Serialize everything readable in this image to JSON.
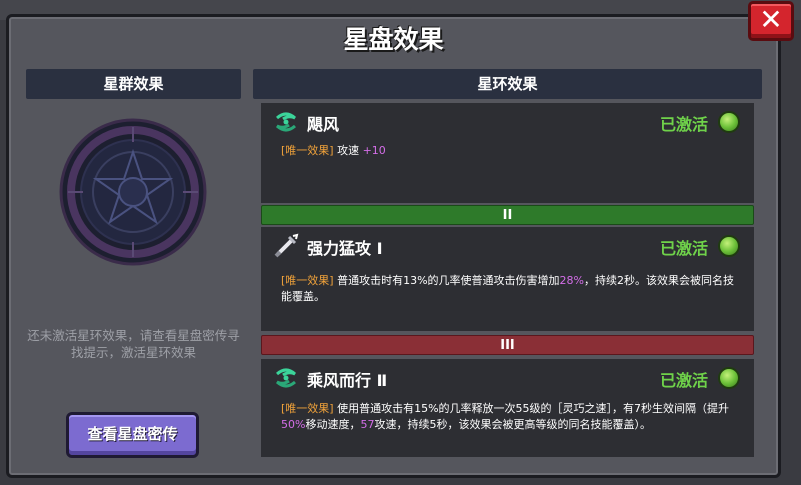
{
  "dialog": {
    "title": "星盘效果",
    "close_label": "✕"
  },
  "constellation": {
    "header": "星群效果",
    "hint": "还未激活星环效果，请查看星盘密传寻找提示，激活星环效果",
    "button_label": "查看星盘密传"
  },
  "ring": {
    "header": "星环效果",
    "dividers": [
      "II",
      "III"
    ],
    "effects": [
      {
        "name": "飓风",
        "icon": "wind-swirl-icon",
        "status": "已激活",
        "tag": "[唯一效果]",
        "desc_parts": [
          " 攻速 ",
          "+10"
        ]
      },
      {
        "name": "强力猛攻 Ⅰ",
        "icon": "sword-strike-icon",
        "status": "已激活",
        "tag": "[唯一效果]",
        "desc_parts": [
          " 普通攻击时有13%的几率使普通攻击伤害增加",
          "28%",
          "，持续2秒。该效果会被同名技能覆盖。"
        ]
      },
      {
        "name": "乘风而行 Ⅱ",
        "icon": "wind-swirl-icon",
        "status": "已激活",
        "tag": "[唯一效果]",
        "desc_parts": [
          " 使用普通攻击有15%的几率释放一次55级的［灵巧之速］，有7秒生效间隔（提升",
          "50%",
          "移动速度，",
          "57",
          "攻速，持续5秒，该效果会被更高等级的同名技能覆盖）。"
        ]
      }
    ]
  },
  "colors": {
    "active_green": "#6fd24a",
    "tag_orange": "#f0a23a",
    "highlight_purple": "#d46ee8",
    "button_purple": "#7c6bd0",
    "close_red": "#d4252d"
  }
}
